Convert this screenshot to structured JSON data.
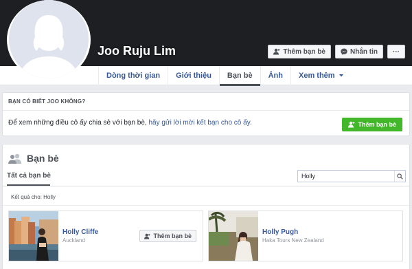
{
  "profile": {
    "name": "Joo Ruju Lim",
    "add_friend_label": "Thêm bạn bè",
    "message_label": "Nhắn tin",
    "more_label": "···"
  },
  "nav": {
    "tabs": [
      {
        "label": "Dòng thời gian"
      },
      {
        "label": "Giới thiệu"
      },
      {
        "label": "Bạn bè"
      },
      {
        "label": "Ảnh"
      },
      {
        "label": "Xem thêm"
      }
    ],
    "active_tab": "Bạn bè"
  },
  "suggest": {
    "title": "BẠN CÓ BIẾT JOO KHÔNG?",
    "text_before": "Để xem những điều cô ấy chia sẻ với bạn bè, ",
    "link_text": "hãy gửi lời mời kết bạn cho cô ấy.",
    "button_label": "Thêm bạn bè"
  },
  "friends": {
    "title": "Bạn bè",
    "subtab": "Tất cả bạn bè",
    "search_value": "Holly",
    "results_label": "Kết quả cho: Holly",
    "items": [
      {
        "name": "Holly Cliffe",
        "location": "Auckland",
        "button_label": "Thêm bạn bè"
      },
      {
        "name": "Holly Pugh",
        "location": "Haka Tours New Zealand"
      }
    ]
  },
  "colors": {
    "link": "#365899",
    "green": "#42b72a",
    "cover": "#1d1f22",
    "page_bg": "#e9ebee"
  }
}
